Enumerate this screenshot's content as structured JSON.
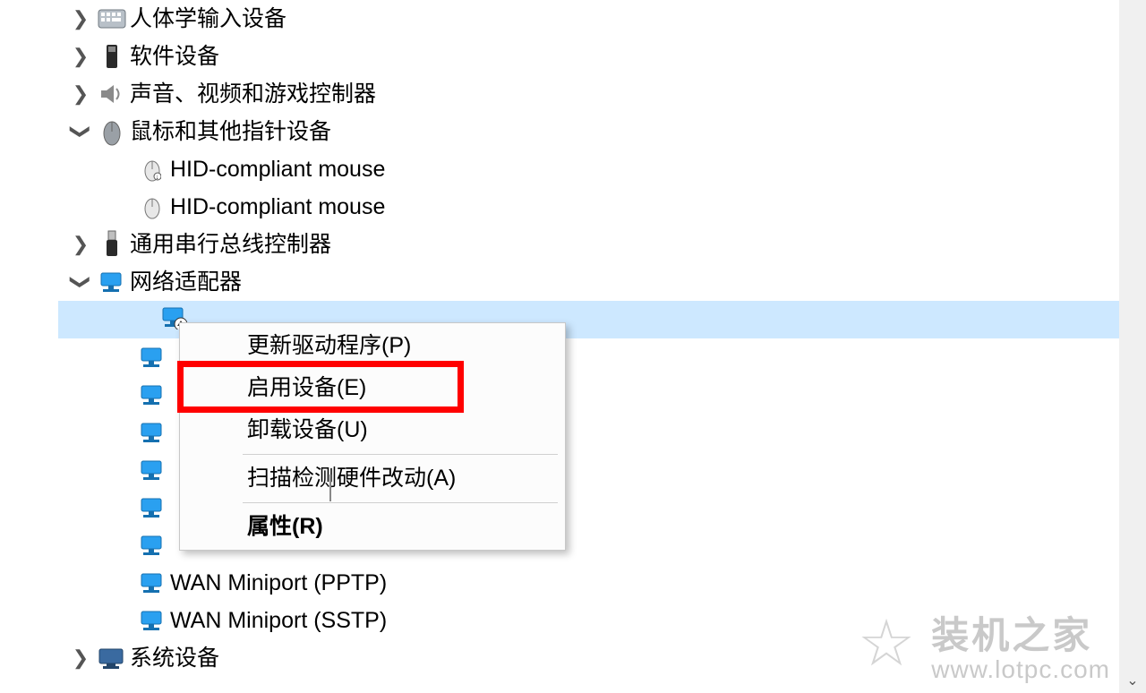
{
  "tree": {
    "items": [
      {
        "label": "人体学输入设备",
        "expanded": "collapsed",
        "icon": "keyboard"
      },
      {
        "label": "软件设备",
        "expanded": "collapsed",
        "icon": "chip"
      },
      {
        "label": "声音、视频和游戏控制器",
        "expanded": "collapsed",
        "icon": "speaker"
      },
      {
        "label": "鼠标和其他指针设备",
        "expanded": "expanded",
        "icon": "mouse",
        "children": [
          {
            "label": "HID-compliant mouse",
            "icon": "mouse-sm"
          },
          {
            "label": "HID-compliant mouse",
            "icon": "mouse-sm"
          }
        ]
      },
      {
        "label": "通用串行总线控制器",
        "expanded": "collapsed",
        "icon": "usb"
      },
      {
        "label": "网络适配器",
        "expanded": "expanded",
        "icon": "net",
        "children": [
          {
            "label": "",
            "icon": "net-disabled",
            "selected": true
          },
          {
            "label": "",
            "icon": "net"
          },
          {
            "label": "",
            "icon": "net"
          },
          {
            "label": "",
            "icon": "net"
          },
          {
            "label": "",
            "icon": "net"
          },
          {
            "label": "",
            "icon": "net"
          },
          {
            "label": "",
            "icon": "net"
          },
          {
            "label": "WAN Miniport (PPTP)",
            "icon": "net"
          },
          {
            "label": "WAN Miniport (SSTP)",
            "icon": "net"
          }
        ]
      },
      {
        "label": "系统设备",
        "expanded": "collapsed",
        "icon": "pc"
      }
    ]
  },
  "context_menu": {
    "items": [
      {
        "id": "update",
        "label": "更新驱动程序(P)"
      },
      {
        "id": "enable",
        "label": "启用设备(E)",
        "highlighted": true
      },
      {
        "id": "uninst",
        "label": "卸载设备(U)"
      },
      {
        "id": "sep1",
        "separator": true
      },
      {
        "id": "scan",
        "label": "扫描检测硬件改动(A)"
      },
      {
        "id": "sep2",
        "separator": true
      },
      {
        "id": "prop",
        "label": "属性(R)",
        "bold": true
      }
    ]
  },
  "watermark": {
    "title": "装机之家",
    "url": "www.lotpc.com"
  }
}
